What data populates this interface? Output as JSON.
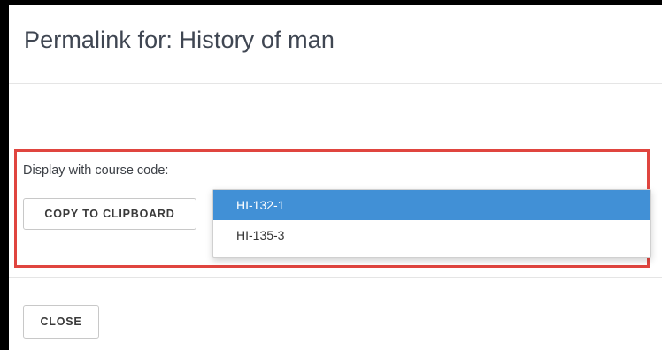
{
  "dialog": {
    "title": "Permalink for: History of man"
  },
  "form": {
    "course_code_label": "Display with course code:",
    "course_code_options": [
      "HI-132-1",
      "HI-135-3"
    ],
    "selected_option": "HI-132-1",
    "copy_button_label": "COPY TO CLIPBOARD"
  },
  "footer": {
    "close_button_label": "CLOSE"
  },
  "colors": {
    "highlight_border": "#e0453f",
    "selected_option_bg": "#4190d6"
  }
}
